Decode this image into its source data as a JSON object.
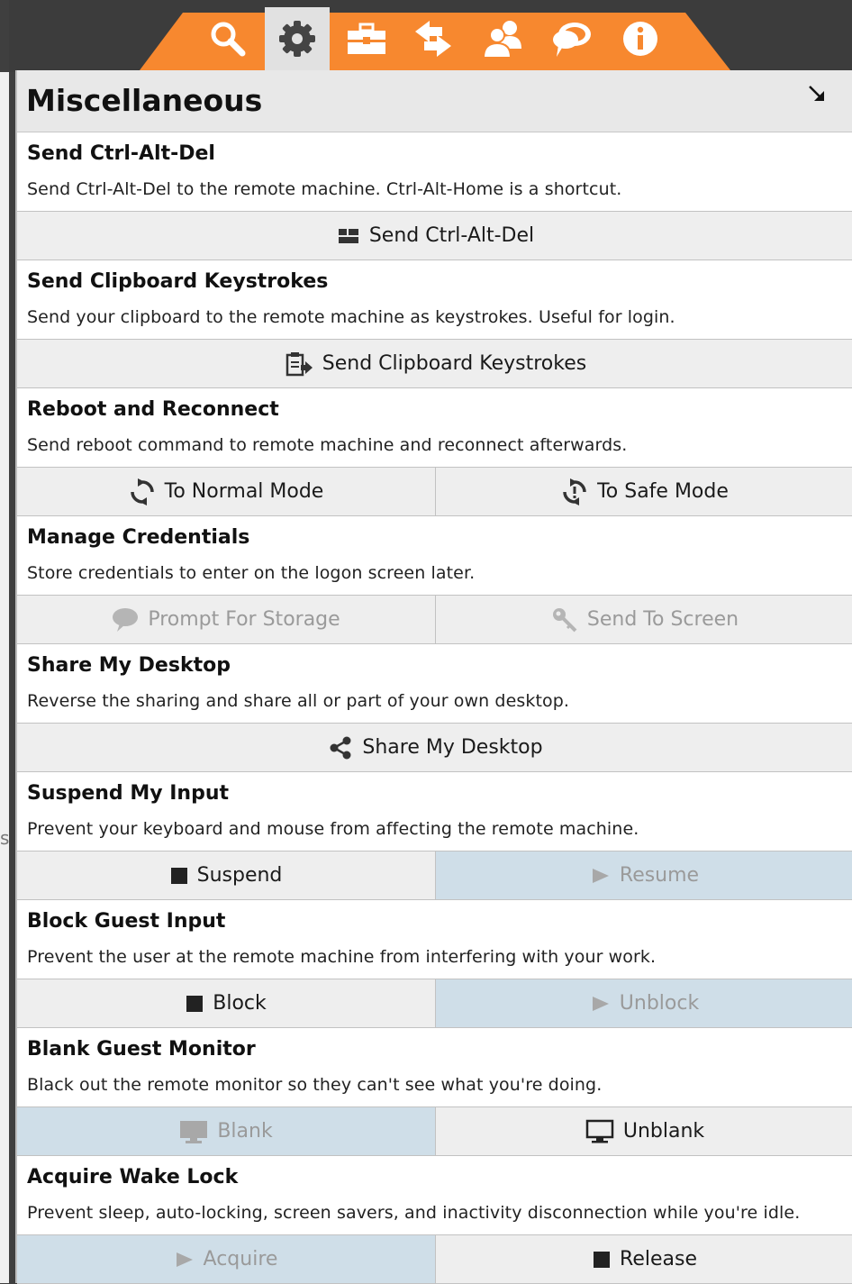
{
  "panel": {
    "title": "Miscellaneous"
  },
  "toolbar": {
    "tabs": [
      {
        "icon": "search-icon",
        "active": false
      },
      {
        "icon": "gear-icon",
        "active": true
      },
      {
        "icon": "toolbox-icon",
        "active": false
      },
      {
        "icon": "transfer-arrows-icon",
        "active": false
      },
      {
        "icon": "users-icon",
        "active": false
      },
      {
        "icon": "chat-icon",
        "active": false
      },
      {
        "icon": "info-icon",
        "active": false
      }
    ],
    "accent": "#f7882f"
  },
  "sections": [
    {
      "title": "Send Ctrl-Alt-Del",
      "desc": "Send Ctrl-Alt-Del to the remote machine. Ctrl-Alt-Home is a shortcut.",
      "buttons": [
        {
          "label": "Send Ctrl-Alt-Del",
          "icon": "keyboard-keys-icon"
        }
      ]
    },
    {
      "title": "Send Clipboard Keystrokes",
      "desc": "Send your clipboard to the remote machine as keystrokes. Useful for login.",
      "buttons": [
        {
          "label": "Send Clipboard Keystrokes",
          "icon": "clipboard-send-icon"
        }
      ]
    },
    {
      "title": "Reboot and Reconnect",
      "desc": "Send reboot command to remote machine and reconnect afterwards.",
      "buttons": [
        {
          "label": "To Normal Mode",
          "icon": "reboot-icon"
        },
        {
          "label": "To Safe Mode",
          "icon": "safe-reboot-icon"
        }
      ]
    },
    {
      "title": "Manage Credentials",
      "desc": "Store credentials to enter on the logon screen later.",
      "buttons": [
        {
          "label": "Prompt For Storage",
          "icon": "speech-bubble-icon",
          "disabled": true
        },
        {
          "label": "Send To Screen",
          "icon": "key-icon",
          "disabled": true
        }
      ]
    },
    {
      "title": "Share My Desktop",
      "desc": "Reverse the sharing and share all or part of your own desktop.",
      "buttons": [
        {
          "label": "Share My Desktop",
          "icon": "share-icon"
        }
      ]
    },
    {
      "title": "Suspend My Input",
      "desc": "Prevent your keyboard and mouse from affecting the remote machine.",
      "buttons": [
        {
          "label": "Suspend",
          "icon": "stop-icon"
        },
        {
          "label": "Resume",
          "icon": "play-icon",
          "disabled": true,
          "selected": true
        }
      ]
    },
    {
      "title": "Block Guest Input",
      "desc": "Prevent the user at the remote machine from interfering with your work.",
      "buttons": [
        {
          "label": "Block",
          "icon": "stop-icon"
        },
        {
          "label": "Unblock",
          "icon": "play-icon",
          "disabled": true,
          "selected": true
        }
      ]
    },
    {
      "title": "Blank Guest Monitor",
      "desc": "Black out the remote monitor so they can't see what you're doing.",
      "buttons": [
        {
          "label": "Blank",
          "icon": "monitor-icon",
          "disabled": true,
          "selected": true
        },
        {
          "label": "Unblank",
          "icon": "monitor-outline-icon"
        }
      ]
    },
    {
      "title": "Acquire Wake Lock",
      "desc": "Prevent sleep, auto-locking, screen savers, and inactivity disconnection while you're idle.",
      "buttons": [
        {
          "label": "Acquire",
          "icon": "play-icon",
          "disabled": true,
          "selected": true
        },
        {
          "label": "Release",
          "icon": "stop-icon"
        }
      ]
    }
  ]
}
